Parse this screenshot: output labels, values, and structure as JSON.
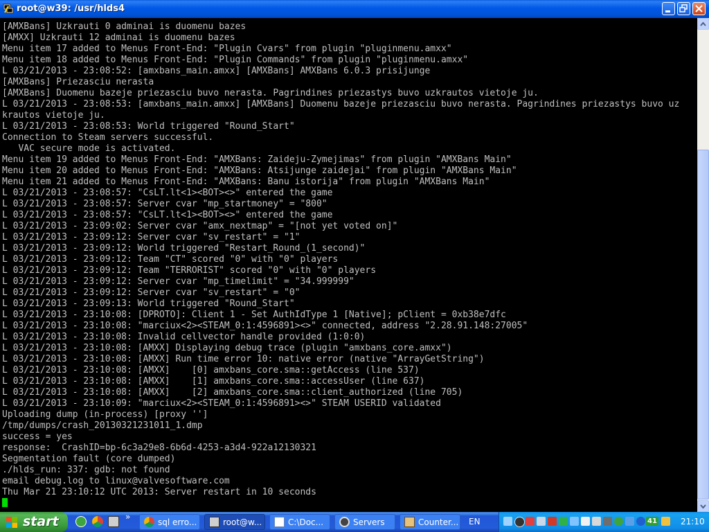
{
  "window": {
    "title": "root@w39: /usr/hlds4",
    "buttons": {
      "minimize_icon": "minimize-icon",
      "maximize_icon": "restore-icon",
      "close_icon": "close-icon"
    }
  },
  "console": {
    "lines": [
      "[AMXBans] Uzkrauti 0 adminai is duomenu bazes",
      "[AMXX] Uzkrauti 12 adminai is duomenu bazes",
      "Menu item 17 added to Menus Front-End: \"Plugin Cvars\" from plugin \"pluginmenu.amxx\"",
      "Menu item 18 added to Menus Front-End: \"Plugin Commands\" from plugin \"pluginmenu.amxx\"",
      "L 03/21/2013 - 23:08:52: [amxbans_main.amxx] [AMXBans] AMXBans 6.0.3 prisijunge",
      "[AMXBans] Priezasciu nerasta",
      "[AMXBans] Duomenu bazeje priezasciu buvo nerasta. Pagrindines priezastys buvo uzkrautos vietoje ju.",
      "L 03/21/2013 - 23:08:53: [amxbans_main.amxx] [AMXBans] Duomenu bazeje priezasciu buvo nerasta. Pagrindines priezastys buvo uz",
      "krautos vietoje ju.",
      "L 03/21/2013 - 23:08:53: World triggered \"Round_Start\"",
      "Connection to Steam servers successful.",
      "   VAC secure mode is activated.",
      "Menu item 19 added to Menus Front-End: \"AMXBans: Zaideju-Zymejimas\" from plugin \"AMXBans Main\"",
      "Menu item 20 added to Menus Front-End: \"AMXBans: Atsijunge zaidejai\" from plugin \"AMXBans Main\"",
      "Menu item 21 added to Menus Front-End: \"AMXBans: Banu istorija\" from plugin \"AMXBans Main\"",
      "L 03/21/2013 - 23:08:57: \"CsLT.lt<1><BOT><>\" entered the game",
      "L 03/21/2013 - 23:08:57: Server cvar \"mp_startmoney\" = \"800\"",
      "L 03/21/2013 - 23:08:57: \"CsLT.lt<1><BOT><>\" entered the game",
      "L 03/21/2013 - 23:09:02: Server cvar \"amx_nextmap\" = \"[not yet voted on]\"",
      "L 03/21/2013 - 23:09:12: Server cvar \"sv_restart\" = \"1\"",
      "L 03/21/2013 - 23:09:12: World triggered \"Restart_Round_(1_second)\"",
      "L 03/21/2013 - 23:09:12: Team \"CT\" scored \"0\" with \"0\" players",
      "L 03/21/2013 - 23:09:12: Team \"TERRORIST\" scored \"0\" with \"0\" players",
      "L 03/21/2013 - 23:09:12: Server cvar \"mp_timelimit\" = \"34.999999\"",
      "L 03/21/2013 - 23:09:12: Server cvar \"sv_restart\" = \"0\"",
      "L 03/21/2013 - 23:09:13: World triggered \"Round_Start\"",
      "L 03/21/2013 - 23:10:08: [DPROTO]: Client 1 - Set AuthIdType 1 [Native]; pClient = 0xb38e7dfc",
      "L 03/21/2013 - 23:10:08: \"marciux<2><STEAM_0:1:4596891><>\" connected, address \"2.28.91.148:27005\"",
      "L 03/21/2013 - 23:10:08: Invalid cellvector handle provided (1:0:0)",
      "L 03/21/2013 - 23:10:08: [AMXX] Displaying debug trace (plugin \"amxbans_core.amxx\")",
      "L 03/21/2013 - 23:10:08: [AMXX] Run time error 10: native error (native \"ArrayGetString\")",
      "L 03/21/2013 - 23:10:08: [AMXX]    [0] amxbans_core.sma::getAccess (line 537)",
      "L 03/21/2013 - 23:10:08: [AMXX]    [1] amxbans_core.sma::accessUser (line 637)",
      "L 03/21/2013 - 23:10:08: [AMXX]    [2] amxbans_core.sma::client_authorized (line 705)",
      "L 03/21/2013 - 23:10:09: \"marciux<2><STEAM_0:1:4596891><>\" STEAM USERID validated",
      "Uploading dump (in-process) [proxy '']",
      "/tmp/dumps/crash_20130321231011_1.dmp",
      "success = yes",
      "response:  CrashID=bp-6c3a29e8-6b6d-4253-a3d4-922a12130321",
      "Segmentation fault (core dumped)",
      "./hlds_run: 337: gdb: not found",
      "email debug.log to linux@valvesoftware.com",
      "Thu Mar 21 23:10:12 UTC 2013: Server restart in 10 seconds"
    ]
  },
  "taskbar": {
    "start_label": "start",
    "quick_launch": [
      "utorrent-icon",
      "chrome-icon",
      "putty-icon"
    ],
    "chevron": "»",
    "tasks": [
      {
        "label": "sql erro...",
        "icon": "chrome-icon",
        "active": false
      },
      {
        "label": "root@w...",
        "icon": "putty-icon",
        "active": true
      },
      {
        "label": "C:\\Doc...",
        "icon": "notepad-icon",
        "active": false
      },
      {
        "label": "Servers",
        "icon": "steam-icon",
        "active": false
      },
      {
        "label": "Counter...",
        "icon": "counter-strike-icon",
        "active": false
      }
    ],
    "language": "EN",
    "tray_badge": "41",
    "clock": "21:10"
  },
  "colors": {
    "console_text": "#c0c0c0",
    "console_bg": "#000000",
    "cursor": "#00e000",
    "titlebar": "#0054e3",
    "taskbar": "#245edb",
    "start_button": "#3c9a3c",
    "tray": "#0f8fe9"
  }
}
